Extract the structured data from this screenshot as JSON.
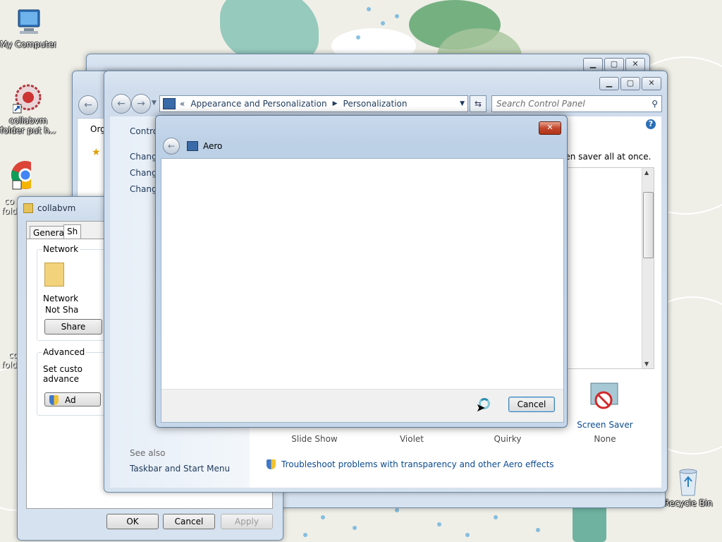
{
  "desktop": {
    "icons": {
      "my_computer": "My Computer",
      "collabvm_1_line1": "collabvm",
      "collabvm_1_line2": "folder put h...",
      "chrome_partial_1": "co",
      "chrome_partial_2": "fold",
      "folder_partial_1": "co",
      "folder_partial_2": "fold",
      "recycle_bin": "Recycle Bin"
    }
  },
  "props_dialog": {
    "title": "collabvm",
    "tabs": [
      "General",
      "Sh"
    ],
    "network_group": "Network",
    "network_label": "Network",
    "not_shared": "Not Sha",
    "share_button": "Share",
    "advanced_group": "Advanced",
    "advanced_text_1": "Set custo",
    "advanced_text_2": "advance",
    "advanced_button": "Ad",
    "ok": "OK",
    "cancel": "Cancel",
    "apply": "Apply"
  },
  "explorer_back": {
    "org_label": "Org"
  },
  "control_panel": {
    "breadcrumb_prefix": "«",
    "breadcrumb": [
      "Appearance and Personalization",
      "Personalization"
    ],
    "search_placeholder": "Search Control Panel",
    "left_links": [
      "Contro",
      "Chang",
      "Chang",
      "Chang"
    ],
    "intro_text": "een saver all at once.",
    "theme_items": [
      {
        "label": "Slide Show"
      },
      {
        "label": "Violet"
      },
      {
        "label": "Quirky"
      },
      {
        "title": "Screen Saver",
        "label": "None"
      }
    ],
    "see_also": "See also",
    "taskbar_link": "Taskbar and Start Menu",
    "troubleshoot_link": "Troubleshoot problems with transparency and other Aero effects"
  },
  "aero_dialog": {
    "title": "Aero",
    "cancel": "Cancel"
  },
  "colors": {
    "link_blue": "#0b4a91",
    "close_red": "#c2472c",
    "frame_blue": "#cfdcec"
  }
}
